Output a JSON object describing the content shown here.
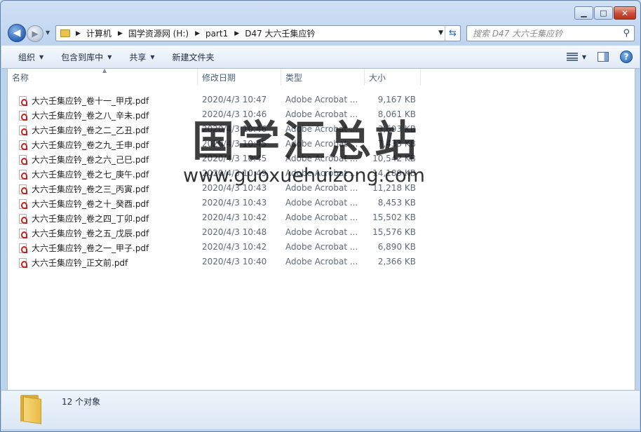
{
  "window": {
    "caption": {
      "minimize": "▁",
      "maximize": "□",
      "close": "✕"
    }
  },
  "nav": {
    "back_glyph": "◀",
    "forward_glyph": "▶",
    "breadcrumbs": [
      "计算机",
      "国学资源网 (H:)",
      "part1",
      "D47 大六壬集应钤"
    ],
    "search_placeholder": "搜索 D47 大六壬集应钤"
  },
  "toolbar": {
    "organize": "组织",
    "include_in_library": "包含到库中",
    "share": "共享",
    "new_folder": "新建文件夹"
  },
  "columns": {
    "name": "名称",
    "date": "修改日期",
    "type": "类型",
    "size": "大小"
  },
  "files": [
    {
      "name": "大六壬集应钤_卷十一_甲戌.pdf",
      "date": "2020/4/3 10:47",
      "type": "Adobe Acrobat ...",
      "size": "9,167 KB"
    },
    {
      "name": "大六壬集应钤_卷之八_辛未.pdf",
      "date": "2020/4/3 10:46",
      "type": "Adobe Acrobat ...",
      "size": "8,061 KB"
    },
    {
      "name": "大六壬集应钤_卷之二_乙丑.pdf",
      "date": "2020/4/3 10:46",
      "type": "Adobe Acrobat ...",
      "size": "3,693 KB"
    },
    {
      "name": "大六壬集应钤_卷之九_壬申.pdf",
      "date": "2020/4/3 10:45",
      "type": "Adobe Acrobat ...",
      "size": "7,433 KB"
    },
    {
      "name": "大六壬集应钤_卷之六_己巳.pdf",
      "date": "2020/4/3 10:45",
      "type": "Adobe Acrobat ...",
      "size": "10,542 KB"
    },
    {
      "name": "大六壬集应钤_卷之七_庚午.pdf",
      "date": "2020/4/3 10:49",
      "type": "Adobe Acrobat ...",
      "size": "14,189 KB"
    },
    {
      "name": "大六壬集应钤_卷之三_丙寅.pdf",
      "date": "2020/4/3 10:43",
      "type": "Adobe Acrobat ...",
      "size": "11,218 KB"
    },
    {
      "name": "大六壬集应钤_卷之十_癸酉.pdf",
      "date": "2020/4/3 10:43",
      "type": "Adobe Acrobat ...",
      "size": "8,453 KB"
    },
    {
      "name": "大六壬集应钤_卷之四_丁卯.pdf",
      "date": "2020/4/3 10:42",
      "type": "Adobe Acrobat ...",
      "size": "15,502 KB"
    },
    {
      "name": "大六壬集应钤_卷之五_戊辰.pdf",
      "date": "2020/4/3 10:48",
      "type": "Adobe Acrobat ...",
      "size": "15,576 KB"
    },
    {
      "name": "大六壬集应钤_卷之一_甲子.pdf",
      "date": "2020/4/3 10:42",
      "type": "Adobe Acrobat ...",
      "size": "6,890 KB"
    },
    {
      "name": "大六壬集应钤_正文前.pdf",
      "date": "2020/4/3 10:40",
      "type": "Adobe Acrobat ...",
      "size": "2,366 KB"
    }
  ],
  "watermark": {
    "chinese": "国学汇总站",
    "url": "www.guoxuehuizong.com"
  },
  "details": {
    "count": "12 个对象"
  },
  "icons": {
    "folder": "folder-icon",
    "pdf": "pdf-file-icon",
    "search": "search-icon",
    "help": "help-icon"
  }
}
